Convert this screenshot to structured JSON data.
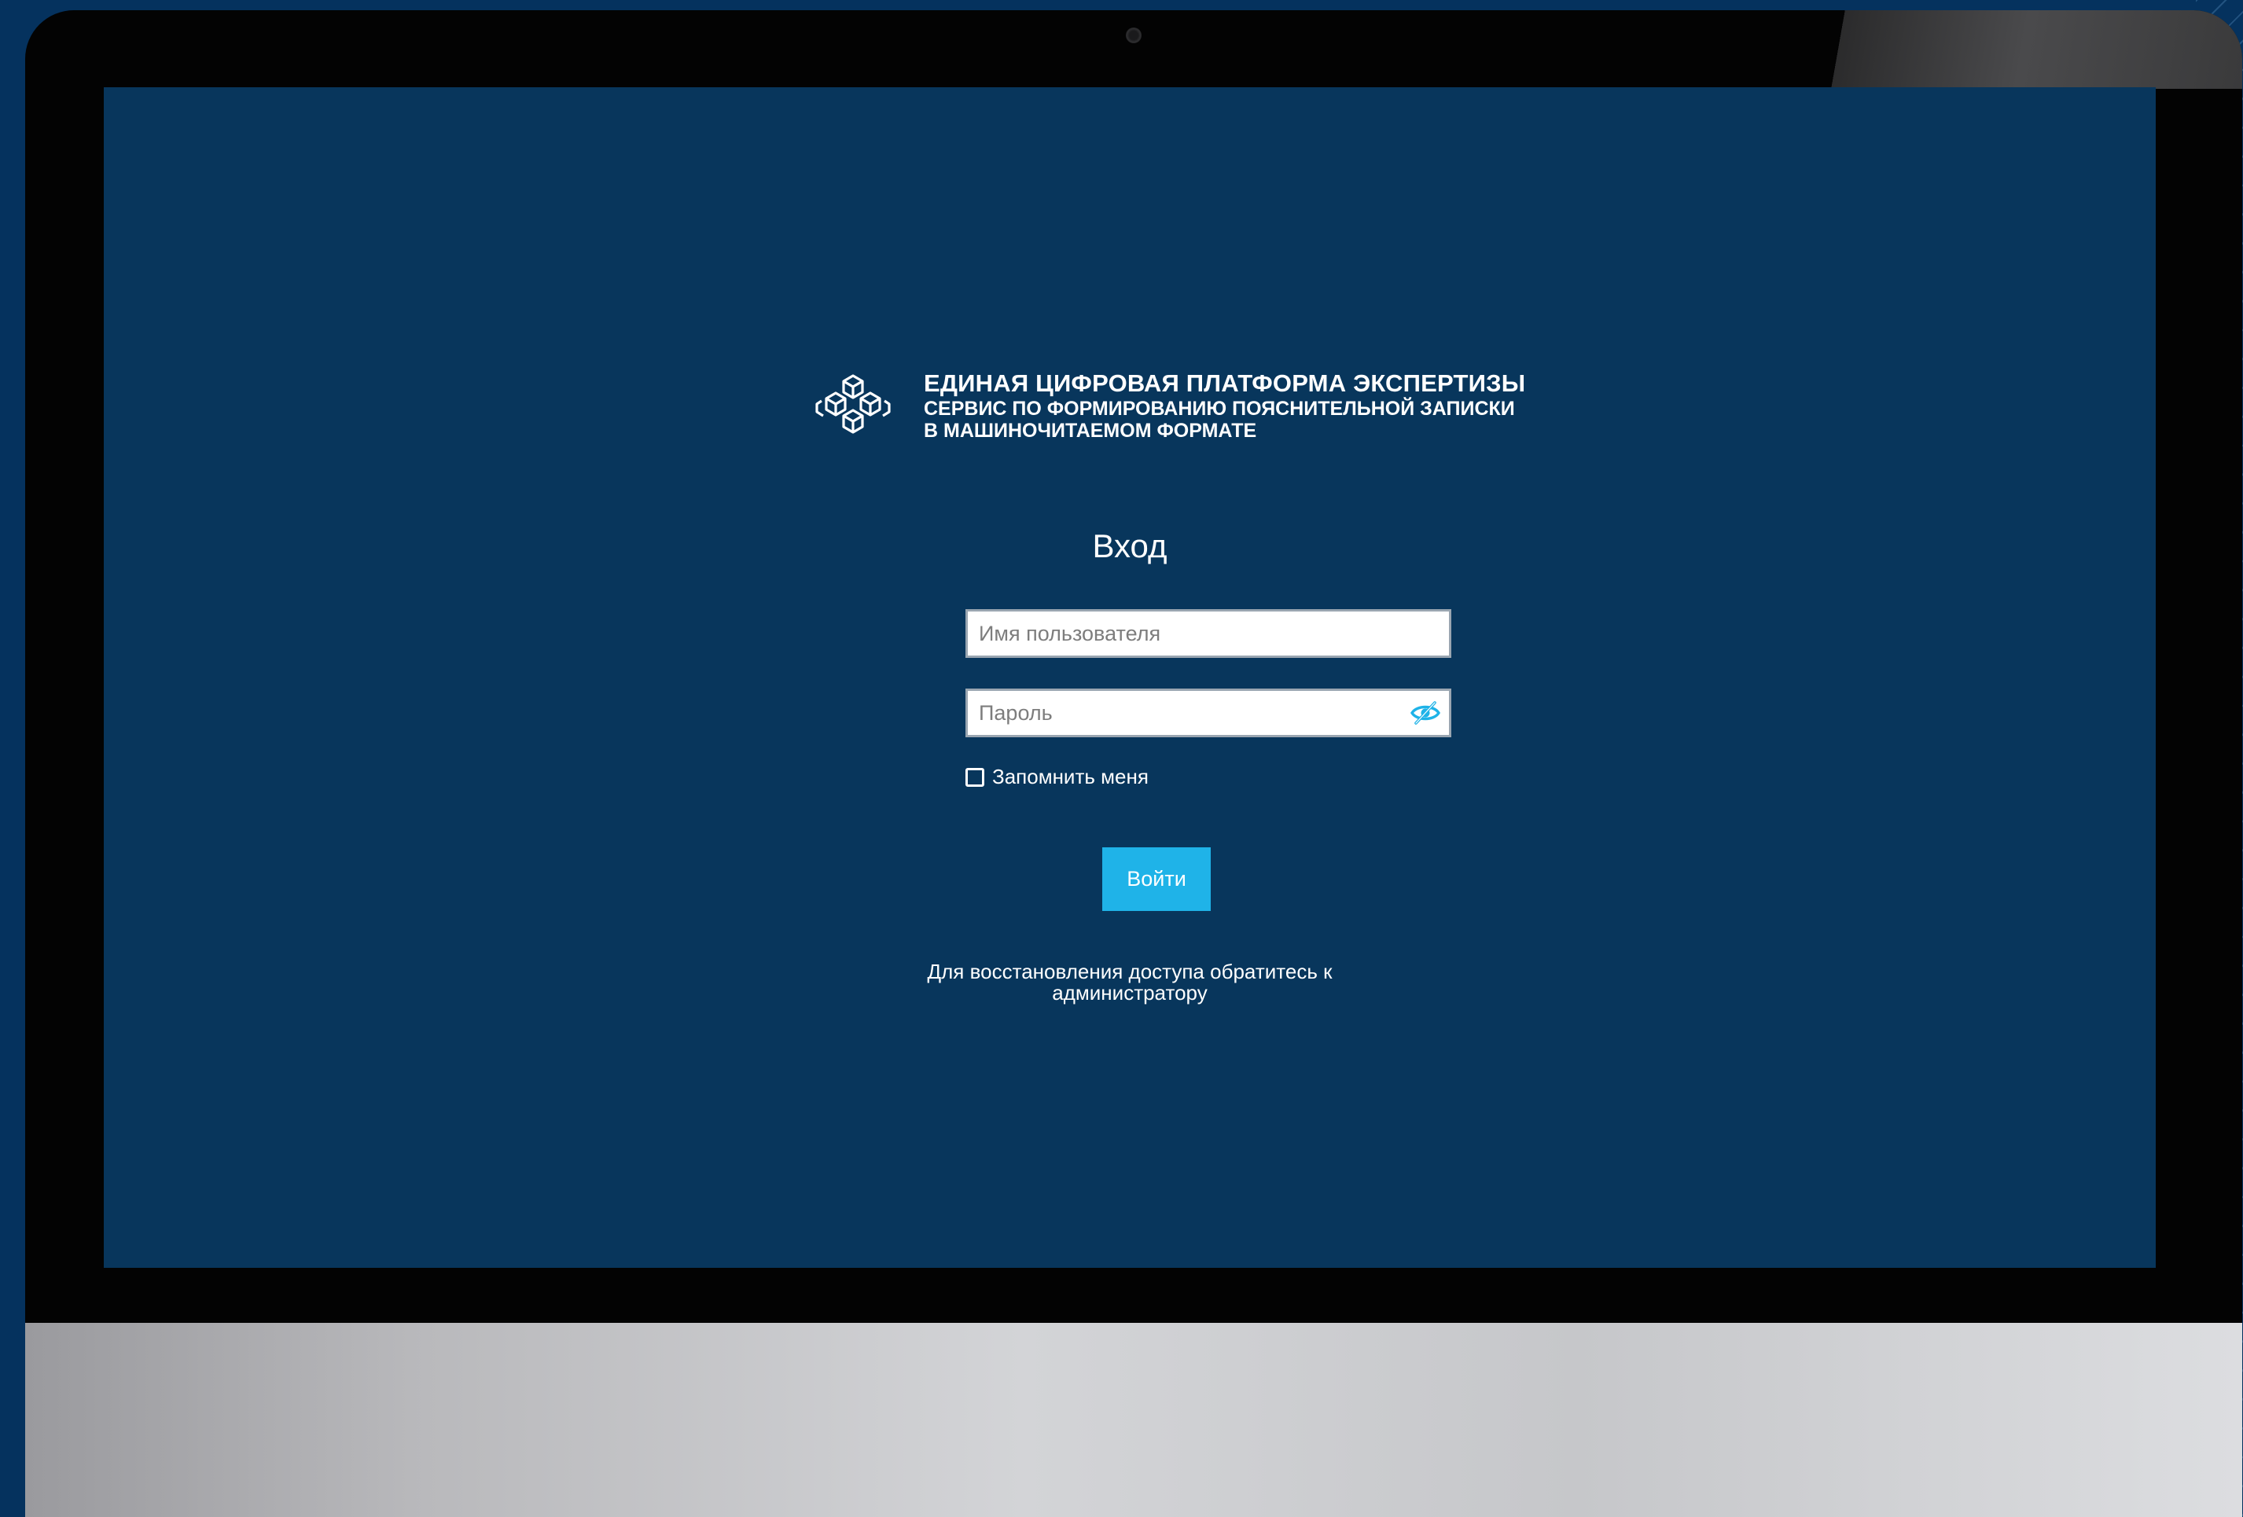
{
  "brand": {
    "line1": "ЕДИНАЯ ЦИФРОВАЯ ПЛАТФОРМА ЭКСПЕРТИЗЫ",
    "line2": "СЕРВИС ПО ФОРМИРОВАНИЮ ПОЯСНИТЕЛЬНОЙ ЗАПИСКИ",
    "line3": "В МАШИНОЧИТАЕМОМ ФОРМАТЕ",
    "logo_icon": "cubes-logo-icon"
  },
  "login": {
    "title": "Вход",
    "username": {
      "value": "",
      "placeholder": "Имя пользователя"
    },
    "password": {
      "value": "",
      "placeholder": "Пароль",
      "toggle_icon": "eye-slash-icon"
    },
    "remember_label": "Запомнить меня",
    "remember_checked": false,
    "submit_label": "Войти",
    "help_line1": "Для восстановления доступа обратитесь к",
    "help_line2": "администратору"
  },
  "colors": {
    "screen_bg": "#08365c",
    "accent": "#1fb3e8",
    "text": "#ffffff"
  }
}
